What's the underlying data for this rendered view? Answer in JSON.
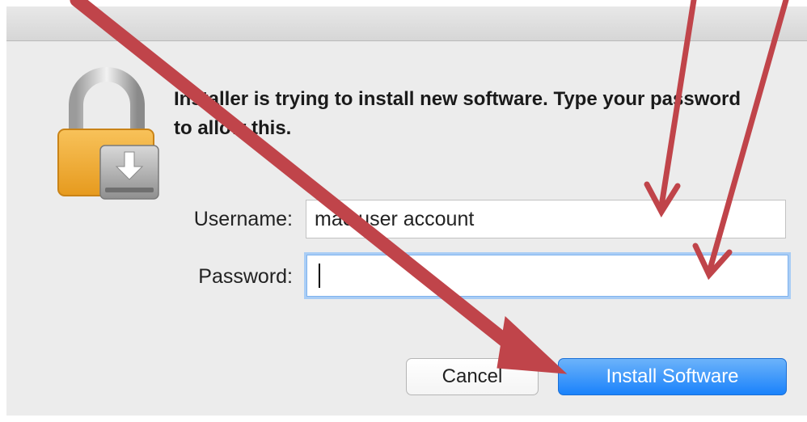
{
  "dialog": {
    "message": "Installer is trying to install new software. Type your password to allow this.",
    "icon": "lock-installer-icon"
  },
  "form": {
    "username_label": "Username:",
    "username_value": "mac user account",
    "password_label": "Password:",
    "password_value": ""
  },
  "buttons": {
    "cancel_label": "Cancel",
    "install_label": "Install Software"
  },
  "colors": {
    "dialog_bg": "#ececec",
    "primary_button": "#1a82fb",
    "focus_ring": "#a9cdf5",
    "annotation_arrow": "#c0444a"
  }
}
